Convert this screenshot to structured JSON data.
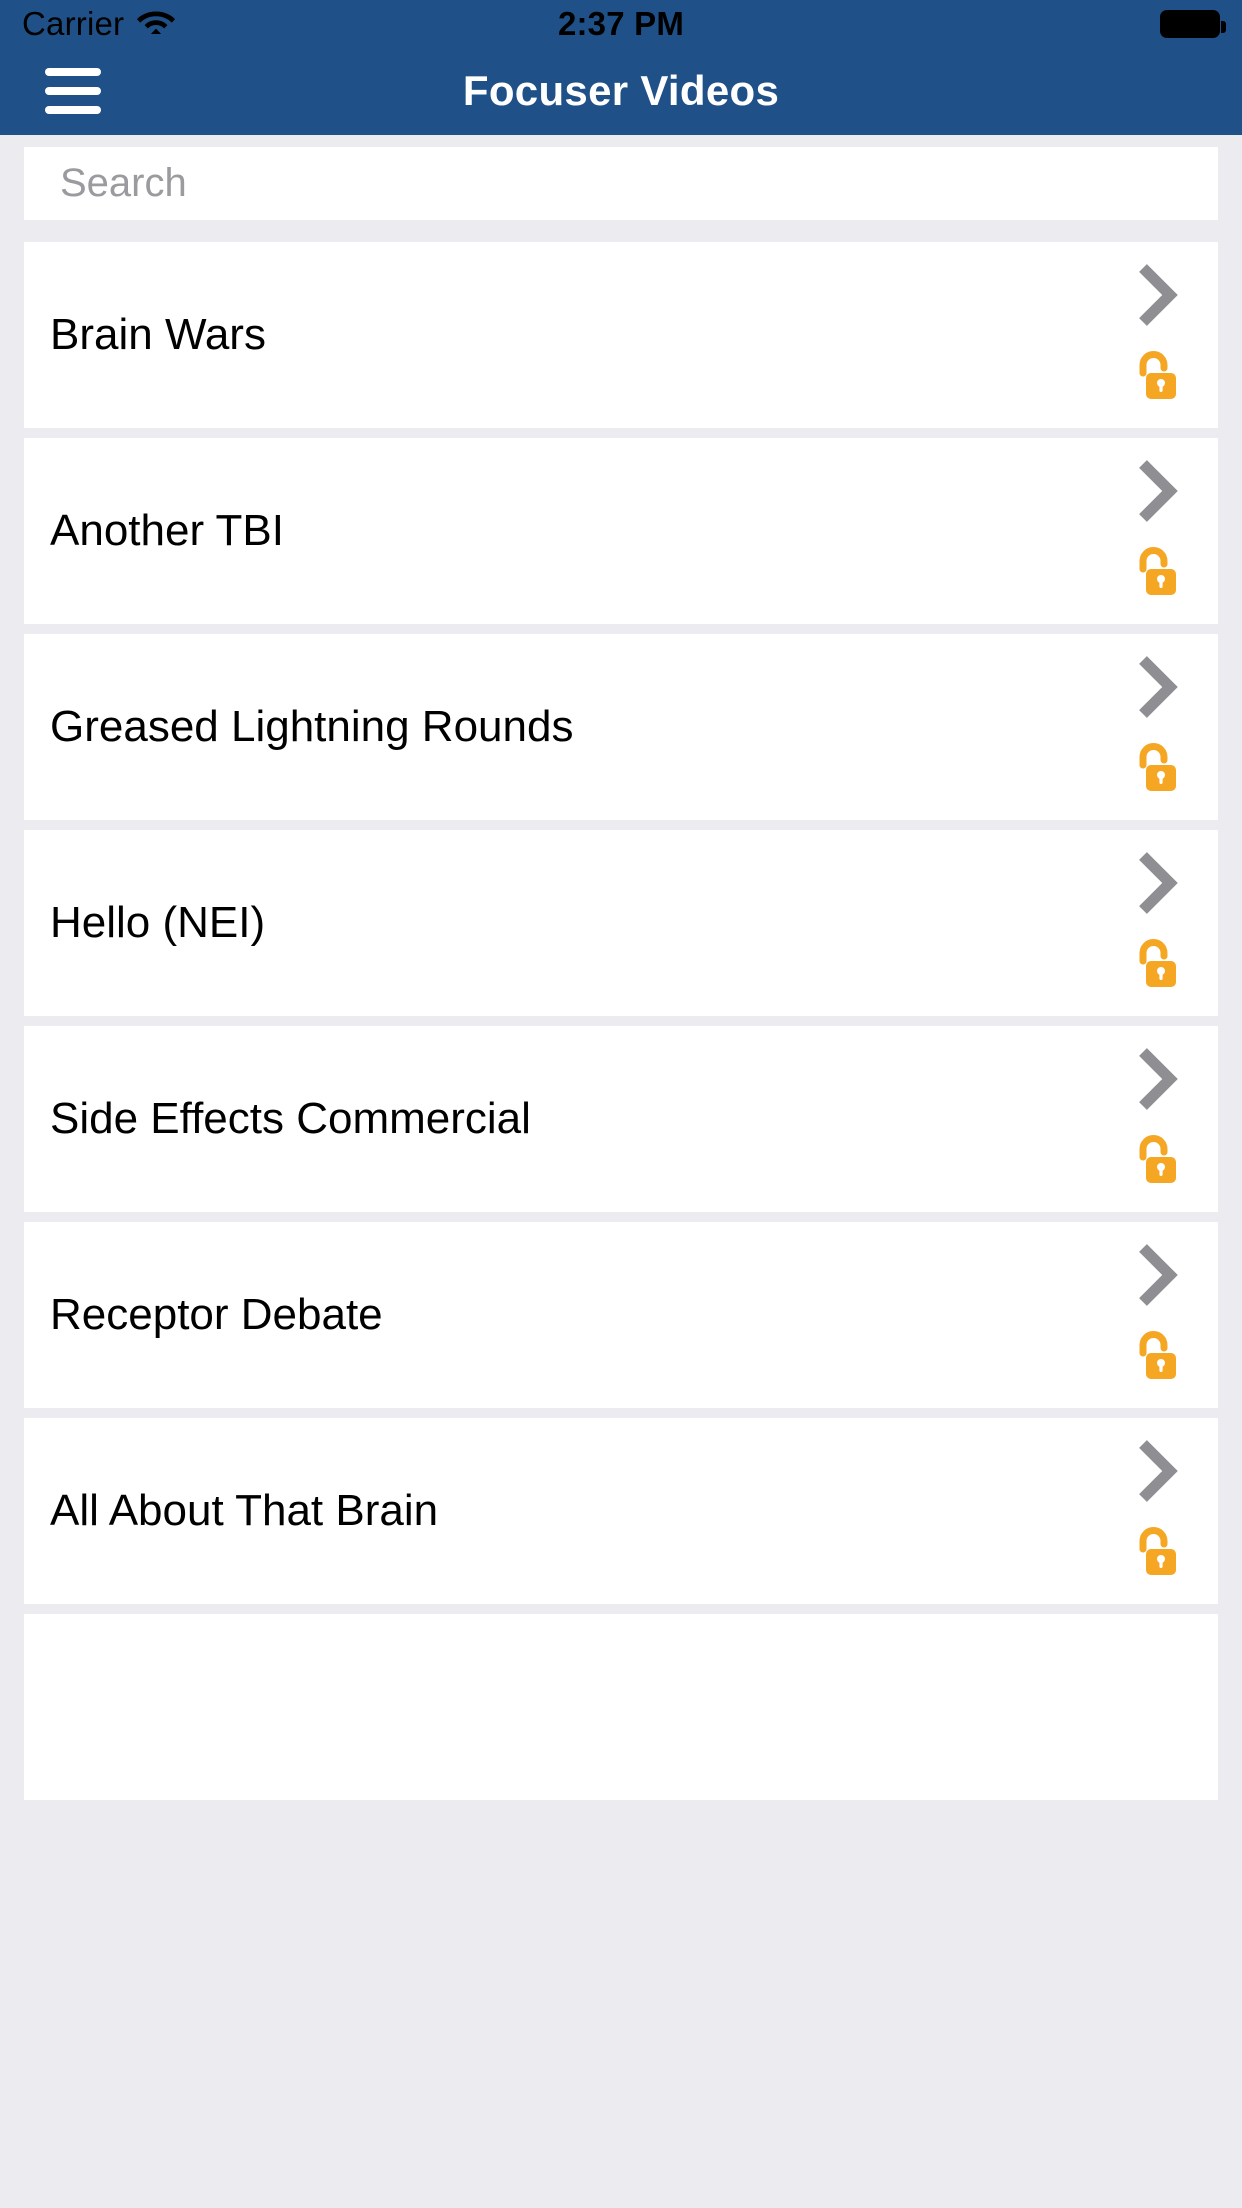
{
  "status_bar": {
    "carrier": "Carrier",
    "wifi_icon": "wifi-icon",
    "time": "2:37 PM",
    "battery_icon": "battery-full-icon"
  },
  "nav_bar": {
    "menu_icon": "hamburger-menu-icon",
    "title": "Focuser Videos",
    "background_color": "#1f5087",
    "title_color": "#ffffff"
  },
  "search": {
    "placeholder": "Search",
    "value": ""
  },
  "colors": {
    "page_background": "#ebebf0",
    "card_background": "#ffffff",
    "chevron": "#8e8e93",
    "lock": "#f5a623",
    "title_text": "#000000",
    "placeholder_text": "#9a9a9f"
  },
  "video_list": {
    "chevron_icon": "chevron-right-icon",
    "lock_icon": "unlock-icon",
    "items": [
      {
        "title": "Brain Wars"
      },
      {
        "title": "Another TBI"
      },
      {
        "title": "Greased Lightning Rounds"
      },
      {
        "title": "Hello (NEI)"
      },
      {
        "title": "Side Effects Commercial"
      },
      {
        "title": "Receptor Debate"
      },
      {
        "title": "All About That Brain"
      },
      {
        "title": ""
      }
    ]
  }
}
